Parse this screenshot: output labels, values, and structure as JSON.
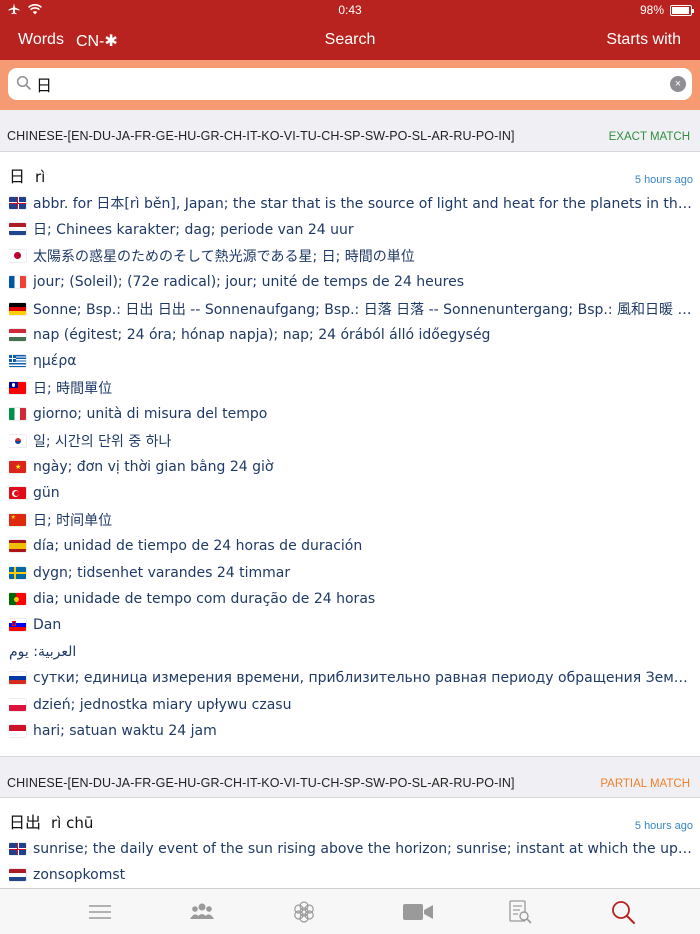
{
  "status": {
    "time": "0:43",
    "battery": "98%"
  },
  "nav": {
    "words": "Words",
    "lang": "CN-✱",
    "title": "Search",
    "mode": "Starts with"
  },
  "search": {
    "value": "日",
    "clear": "×"
  },
  "sections": [
    {
      "lang": "CHINESE-[EN-DU-JA-FR-GE-HU-GR-CH-IT-KO-VI-TU-CH-SP-SW-PO-SL-AR-RU-PO-IN]",
      "match": "EXACT MATCH",
      "match_color": "#2f8f3c"
    },
    {
      "lang": "CHINESE-[EN-DU-JA-FR-GE-HU-GR-CH-IT-KO-VI-TU-CH-SP-SW-PO-SL-AR-RU-PO-IN]",
      "match": "PARTIAL MATCH",
      "match_color": "#f07f2a"
    }
  ],
  "entries": [
    {
      "headword": "日",
      "pinyin": "rì",
      "time": "5 hours ago",
      "translations": [
        {
          "flag": "gb",
          "text": "abbr. for 日本[rì běn], Japan; the star that is the source of light and heat for the planets in the solar system; day; date, day of the month; a Chinese character; dimension of time, 24 hours"
        },
        {
          "flag": "nl",
          "text": "日; Chinees karakter; dag; periode van 24 uur"
        },
        {
          "flag": "jp",
          "text": "太陽系の惑星のためのそして熱光源である星; 日; 時間の単位"
        },
        {
          "flag": "fr",
          "text": "jour; (Soleil); (72e radical); jour; unité de temps de 24 heures"
        },
        {
          "flag": "de",
          "text": "Sonne; Bsp.: 日出 日出 -- Sonnenaufgang; Bsp.: 日落 日落 -- Sonnenuntergang; Bsp.: 風和日暖 风和日暖 -- sonnig und mild"
        },
        {
          "flag": "hu",
          "text": "nap (égitest; 24 óra; hónap napja); nap; 24 órából álló időegység"
        },
        {
          "flag": "gr",
          "text": "ημέρα"
        },
        {
          "flag": "tw",
          "text": "日; 時間單位"
        },
        {
          "flag": "it",
          "text": "giorno; unità di misura del tempo"
        },
        {
          "flag": "kr",
          "text": "일; 시간의 단위 중 하나"
        },
        {
          "flag": "vn",
          "text": "ngày; đơn vị thời gian bằng 24 giờ"
        },
        {
          "flag": "tr",
          "text": "gün"
        },
        {
          "flag": "cn",
          "text": "日; 时间单位"
        },
        {
          "flag": "es",
          "text": "día; unidad de tiempo de 24 horas de duración"
        },
        {
          "flag": "se",
          "text": "dygn; tidsenhet varandes 24 timmar"
        },
        {
          "flag": "pt",
          "text": "dia; unidade de tempo com duração de 24 horas"
        },
        {
          "flag": "si",
          "text": "Dan"
        },
        {
          "flag": "ar",
          "text": "العربية: يوم"
        },
        {
          "flag": "ru",
          "text": "сутки; единица измерения времени, приблизительно равная периоду обращения Земли вокруг своей оси"
        },
        {
          "flag": "pl",
          "text": "dzień; jednostka miary upływu czasu"
        },
        {
          "flag": "id",
          "text": "hari; satuan waktu 24 jam"
        }
      ]
    },
    {
      "headword": "日出",
      "pinyin": "rì chū",
      "time": "5 hours ago",
      "translations": [
        {
          "flag": "gb",
          "text": "sunrise; the daily event of the sun rising above the horizon; sunrise; instant at which the upper edge of the sun appears"
        },
        {
          "flag": "nl",
          "text": "zonsopkomst"
        }
      ]
    }
  ],
  "tabs": [
    {
      "name": "menu-icon"
    },
    {
      "name": "community-icon"
    },
    {
      "name": "flower-icon"
    },
    {
      "name": "video-icon"
    },
    {
      "name": "quiz-icon"
    },
    {
      "name": "search-tab-icon",
      "active_color": "#b8231f"
    }
  ],
  "colors": {
    "brand": "#b8231f",
    "search_band": "#f69a74",
    "link_time": "#3a86c8",
    "translation_text": "#1f3a66"
  }
}
